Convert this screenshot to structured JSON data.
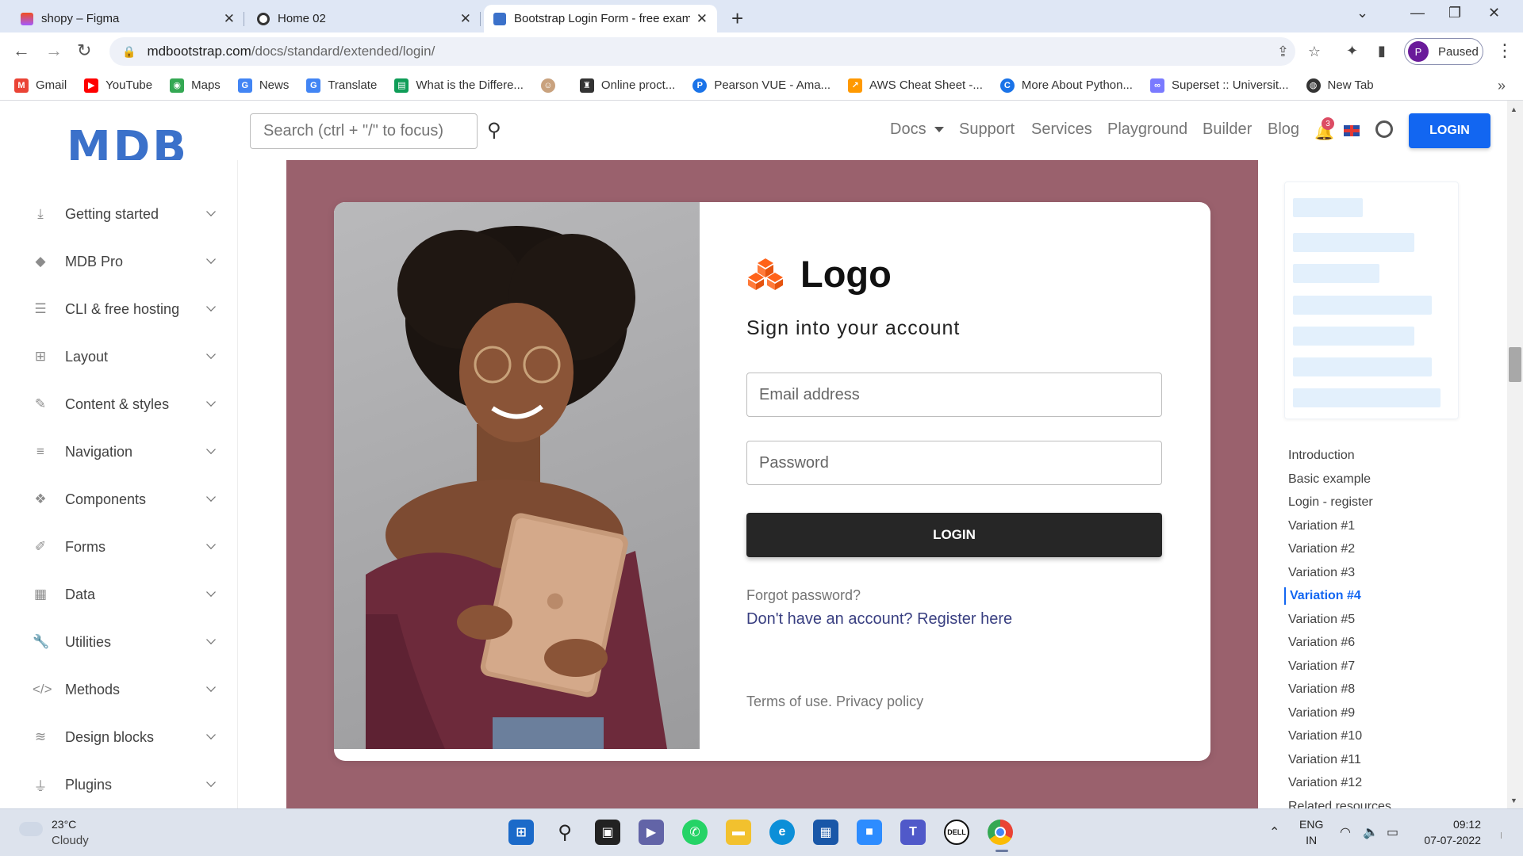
{
  "browser": {
    "tabs": [
      {
        "title": "shopy – Figma"
      },
      {
        "title": "Home 02"
      },
      {
        "title": "Bootstrap Login Form - free exam"
      }
    ],
    "url_host": "mdbootstrap.com",
    "url_path": "/docs/standard/extended/login/",
    "profile_initial": "P",
    "profile_status": "Paused",
    "bookmarks": [
      {
        "label": "Gmail",
        "color": "#ea4335"
      },
      {
        "label": "YouTube",
        "color": "#ff0000"
      },
      {
        "label": "Maps",
        "color": "#34a853"
      },
      {
        "label": "News",
        "color": "#4285f4"
      },
      {
        "label": "Translate",
        "color": "#4285f4"
      },
      {
        "label": "What is the Differe...",
        "color": "#0f9d58"
      },
      {
        "label": "",
        "color": "#c9a27e"
      },
      {
        "label": "Online proct...",
        "color": "#333333"
      },
      {
        "label": "Pearson VUE - Ama...",
        "color": "#1a73e8"
      },
      {
        "label": "AWS Cheat Sheet -...",
        "color": "#ff9900"
      },
      {
        "label": "More About Python...",
        "color": "#1a73e8"
      },
      {
        "label": "Superset :: Universit...",
        "color": "#7a7aff"
      },
      {
        "label": "New Tab",
        "color": "#333333"
      }
    ]
  },
  "header": {
    "logo": "MDB",
    "search_placeholder": "Search (ctrl + \"/\" to focus)",
    "nav": [
      "Docs",
      "Support",
      "Services",
      "Playground",
      "Builder",
      "Blog"
    ],
    "notification_count": "3",
    "login_label": "LOGIN",
    "accent": "#1266f1"
  },
  "sidebar": {
    "items": [
      {
        "label": "Getting started",
        "icon": "download-icon"
      },
      {
        "label": "MDB Pro",
        "icon": "gem-icon"
      },
      {
        "label": "CLI & free hosting",
        "icon": "database-icon"
      },
      {
        "label": "Layout",
        "icon": "layout-icon"
      },
      {
        "label": "Content & styles",
        "icon": "brush-icon"
      },
      {
        "label": "Navigation",
        "icon": "bars-icon"
      },
      {
        "label": "Components",
        "icon": "cubes-icon"
      },
      {
        "label": "Forms",
        "icon": "edit-icon"
      },
      {
        "label": "Data",
        "icon": "table-icon"
      },
      {
        "label": "Utilities",
        "icon": "wrench-icon"
      },
      {
        "label": "Methods",
        "icon": "code-icon"
      },
      {
        "label": "Design blocks",
        "icon": "layers-icon"
      },
      {
        "label": "Plugins",
        "icon": "plug-icon"
      }
    ]
  },
  "login_card": {
    "brand": "Logo",
    "title": "Sign into your account",
    "email_placeholder": "Email address",
    "password_placeholder": "Password",
    "button": "LOGIN",
    "forgot": "Forgot password?",
    "register": "Don't have an account? Register here",
    "terms": "Terms of use. Privacy policy",
    "background_color": "#9a616d",
    "brand_color": "#ff6219"
  },
  "toc": {
    "items": [
      "Introduction",
      "Basic example",
      "Login - register",
      "Variation #1",
      "Variation #2",
      "Variation #3",
      "Variation #4",
      "Variation #5",
      "Variation #6",
      "Variation #7",
      "Variation #8",
      "Variation #9",
      "Variation #10",
      "Variation #11",
      "Variation #12",
      "Related resources"
    ],
    "active": "Variation #4"
  },
  "taskbar": {
    "temperature": "23°C",
    "condition": "Cloudy",
    "lang_top": "ENG",
    "lang_bottom": "IN",
    "time": "09:12",
    "date": "07-07-2022"
  }
}
